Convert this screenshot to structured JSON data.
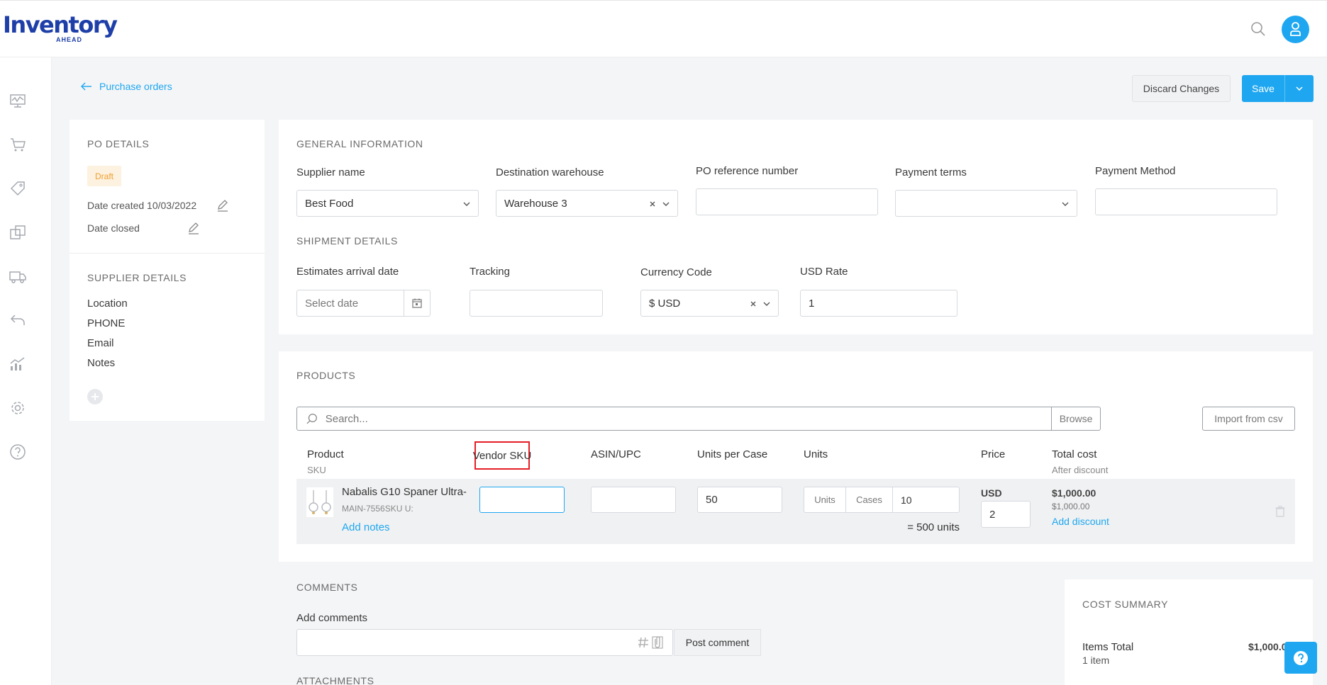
{
  "app": {
    "logo_main": "Inventory",
    "logo_sub": "AHEAD"
  },
  "header": {
    "search_icon": "search-icon",
    "avatar_icon": "user-icon"
  },
  "sidebar": {
    "items": [
      "dashboard-icon",
      "cart-icon",
      "tag-icon",
      "copy-icon",
      "truck-icon",
      "return-icon",
      "analytics-icon",
      "gear-icon",
      "help-icon"
    ]
  },
  "breadcrumb": {
    "back_label": "Purchase orders"
  },
  "toolbar": {
    "discard_label": "Discard Changes",
    "save_label": "Save"
  },
  "po_details": {
    "title": "PO DETAILS",
    "status": "Draft",
    "date_created_label": "Date created 10/03/2022",
    "date_closed_label": "Date closed"
  },
  "supplier_details": {
    "title": "SUPPLIER DETAILS",
    "location": "Location",
    "phone": "PHONE",
    "email": "Email",
    "notes": "Notes"
  },
  "general": {
    "title": "GENERAL INFORMATION",
    "supplier_label": "Supplier name",
    "supplier_value": "Best Food",
    "warehouse_label": "Destination warehouse",
    "warehouse_value": "Warehouse 3",
    "ref_label": "PO reference number",
    "ref_value": "",
    "terms_label": "Payment terms",
    "terms_value": "",
    "method_label": "Payment Method",
    "method_value": ""
  },
  "shipment": {
    "title": "SHIPMENT DETAILS",
    "arrival_label": "Estimates arrival date",
    "arrival_placeholder": "Select date",
    "tracking_label": "Tracking",
    "tracking_value": "",
    "currency_label": "Currency Code",
    "currency_value": "$ USD",
    "rate_label": "USD Rate",
    "rate_value": "1"
  },
  "products": {
    "title": "PRODUCTS",
    "search_placeholder": "Search...",
    "browse_label": "Browse",
    "import_label": "Import from csv",
    "columns": {
      "product": "Product",
      "product_sub": "SKU",
      "vendor_sku": "Vendor SKU",
      "asin": "ASIN/UPC",
      "units_per_case": "Units per Case",
      "units": "Units",
      "price": "Price",
      "total": "Total cost",
      "total_sub": "After discount"
    },
    "row": {
      "name": "Nabalis G10 Spaner Ultra-",
      "sku": "MAIN-7556SKU U:",
      "add_notes": "Add notes",
      "vendor_sku_value": "",
      "asin_value": "",
      "units_per_case_value": "50",
      "toggle_units": "Units",
      "toggle_cases": "Cases",
      "cases_value": "10",
      "units_total": "= 500 units",
      "currency": "USD",
      "price_value": "2",
      "total": "$1,000.00",
      "total_after": "$1,000.00",
      "add_discount": "Add discount"
    }
  },
  "comments": {
    "title": "COMMENTS",
    "add_label": "Add comments",
    "placeholder": "",
    "post_label": "Post comment",
    "attachments_title": "ATTACHMENTS"
  },
  "cost_summary": {
    "title": "COST SUMMARY",
    "items_total_label": "Items Total",
    "items_count": "1 item",
    "items_total_value": "$1,000.0"
  },
  "colors": {
    "accent": "#1ea7f0",
    "brand": "#1e3fa8",
    "draft_bg": "#fdf1df",
    "draft_text": "#f0a030",
    "highlight": "#e41e26"
  }
}
